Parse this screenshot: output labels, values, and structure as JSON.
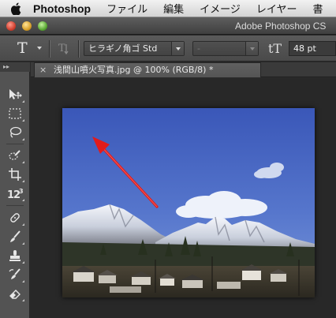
{
  "menubar": {
    "app_name": "Photoshop",
    "items": [
      "ファイル",
      "編集",
      "イメージ",
      "レイヤー",
      "書"
    ]
  },
  "window": {
    "title": "Adobe Photoshop CS"
  },
  "options": {
    "tool_icon": "horizontal-type-tool-icon",
    "font_family": "ヒラギノ角ゴ Std",
    "font_style": "-",
    "font_size": "48 pt"
  },
  "document": {
    "tab_close": "×",
    "tab_title": "浅間山噴火写真.jpg @ 100% (RGB/8) *"
  },
  "toolbar": {
    "panel_grip": "▸▸",
    "tools": [
      "move-tool-icon",
      "marquee-tool-icon",
      "lasso-tool-icon",
      "quick-select-tool-icon",
      "crop-tool-icon",
      "ruler-tool-icon",
      "healing-brush-tool-icon",
      "brush-tool-icon",
      "clone-stamp-tool-icon",
      "history-brush-tool-icon",
      "eraser-tool-icon"
    ]
  },
  "colors": {
    "accent_arrow": "#e21b1b",
    "sky_top": "#3a57b8",
    "sky_bottom": "#7a98da"
  }
}
